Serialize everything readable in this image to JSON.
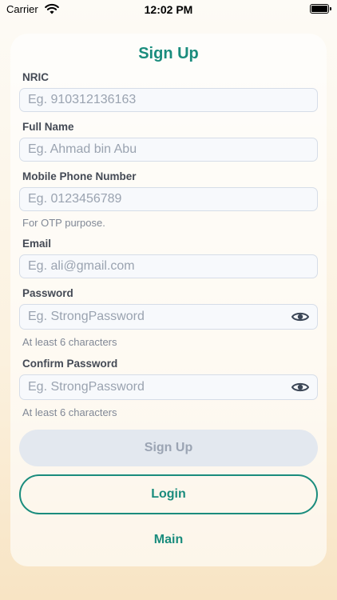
{
  "status_bar": {
    "carrier": "Carrier",
    "time": "12:02 PM"
  },
  "form": {
    "title": "Sign Up",
    "nric": {
      "label": "NRIC",
      "placeholder": "Eg. 910312136163"
    },
    "full_name": {
      "label": "Full Name",
      "placeholder": "Eg. Ahmad bin Abu"
    },
    "mobile": {
      "label": "Mobile Phone Number",
      "placeholder": "Eg. 0123456789",
      "hint": "For OTP purpose."
    },
    "email": {
      "label": "Email",
      "placeholder": "Eg. ali@gmail.com"
    },
    "password": {
      "label": "Password",
      "placeholder": "Eg. StrongPassword",
      "hint": "At least 6 characters"
    },
    "confirm_password": {
      "label": "Confirm Password",
      "placeholder": "Eg. StrongPassword",
      "hint": "At least 6 characters"
    },
    "signup_button": "Sign Up",
    "login_button": "Login",
    "main_link": "Main"
  },
  "colors": {
    "accent": "#1a8c7d",
    "disabled_button_bg": "#e3e8ef",
    "disabled_button_text": "#9ba4b3"
  },
  "icons": {
    "status": [
      "wifi-icon",
      "battery-icon"
    ],
    "password_toggle": "eye-icon"
  }
}
